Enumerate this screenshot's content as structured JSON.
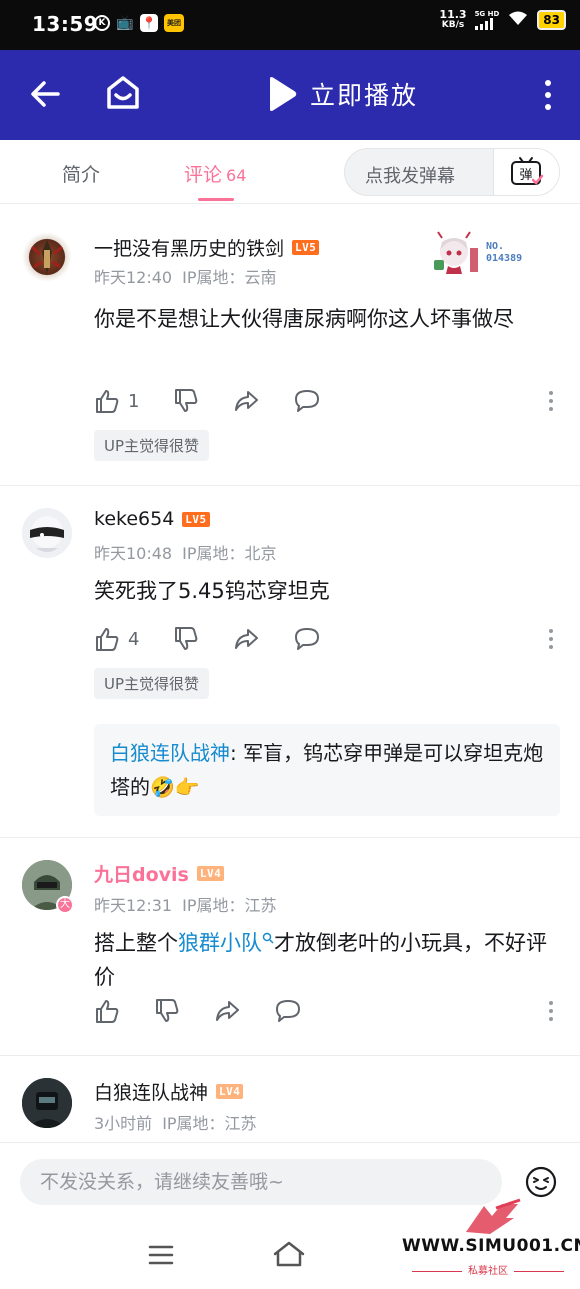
{
  "status_bar": {
    "time": "13:59",
    "net_speed_value": "11.3",
    "net_speed_unit": "KB/s",
    "signal_label": "5G HD",
    "battery": "83",
    "meituan_label": "美团"
  },
  "header": {
    "play_label": "立即播放"
  },
  "tabs": {
    "intro_label": "简介",
    "comments_label": "评论",
    "comments_count": "64",
    "danmaku_placeholder": "点我发弹幕",
    "danmaku_icon_label": "弹"
  },
  "comments": [
    {
      "username": "一把没有黑历史的铁剑",
      "level": "LV5",
      "time": "昨天12:40",
      "ip": "IP属地：云南",
      "content": "你是不是想让大伙得唐尿病啊你这人坏事做尽",
      "likes": "1",
      "up_badge": "UP主觉得很赞",
      "fan_badge_no": "NO.",
      "fan_badge_id": "014389"
    },
    {
      "username": "keke654",
      "level": "LV5",
      "time": "昨天10:48",
      "ip": "IP属地：北京",
      "content": "笑死我了5.45钨芯穿坦克",
      "likes": "4",
      "up_badge": "UP主觉得很赞",
      "reply_name": "白狼连队战神",
      "reply_text": ": 军盲，钨芯穿甲弹是可以穿坦克炮塔的🤣👉"
    },
    {
      "username": "九日dovis",
      "level": "LV4",
      "time": "昨天12:31",
      "ip": "IP属地：江苏",
      "content_before": "搭上整个",
      "content_link": "狼群小队",
      "content_after": "才放倒老叶的小玩具，不好评价",
      "avatar_badge": "大"
    },
    {
      "username": "白狼连队战神",
      "level": "LV4",
      "time": "3小时前",
      "ip": "IP属地：江苏"
    }
  ],
  "bottom": {
    "input_placeholder": "不发没关系，请继续友善哦~"
  },
  "watermark": {
    "text": "WWW.SIMU001.CN",
    "sub": "私募社区"
  },
  "colors": {
    "header_bg": "#2d2bad",
    "accent_pink": "#fb7299",
    "link_blue": "#178bcf",
    "lv5": "#ff6d1f",
    "lv4": "#ffb37c"
  }
}
